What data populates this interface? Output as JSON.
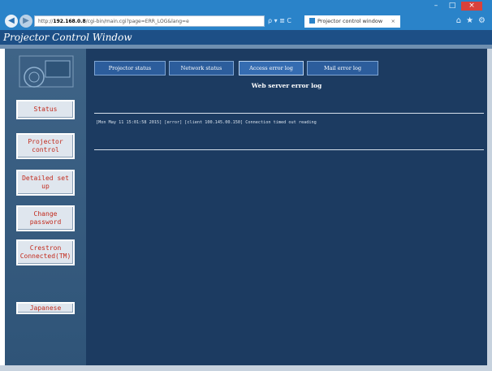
{
  "browser": {
    "address_prefix": "http://",
    "address_host": "192.168.0.8",
    "address_path": "/cgi-bin/main.cgi?page=ERR_LOG&lang=e",
    "tab_title": "Projector control window",
    "tab_close": "×",
    "back": "◀",
    "forward": "▶",
    "addr_icons": "ρ ▾ ≣ C",
    "tools": [
      "⌂",
      "★",
      "⚙"
    ],
    "win_controls": [
      "–",
      "□",
      "×"
    ]
  },
  "app": {
    "title": "Projector Control Window"
  },
  "sidebar": {
    "buttons": [
      {
        "label": "Status"
      },
      {
        "label": "Projector control"
      },
      {
        "label": "Detailed set up"
      },
      {
        "label": "Change password"
      },
      {
        "label": "Crestron Connected(TM)"
      },
      {
        "label": "Japanese"
      }
    ]
  },
  "main": {
    "tabs": [
      {
        "label": "Projector status"
      },
      {
        "label": "Network status"
      },
      {
        "label": "Access error log"
      },
      {
        "label": "Mail error log"
      }
    ],
    "active_tab": "Access error log",
    "log_title": "Web server error log",
    "log_entries": [
      "[Mon May 11 15:01:58 2015] [error] [client 100.145.00.150] Connection timed out reading"
    ]
  },
  "colors": {
    "browser_bar": "#2a83c9",
    "title_bar": "#1d4f86",
    "sidebar": "#3f6487",
    "main_bg": "#1c3b61",
    "tab_bg": "#2c5d9c",
    "button_text": "#c22a1c"
  }
}
